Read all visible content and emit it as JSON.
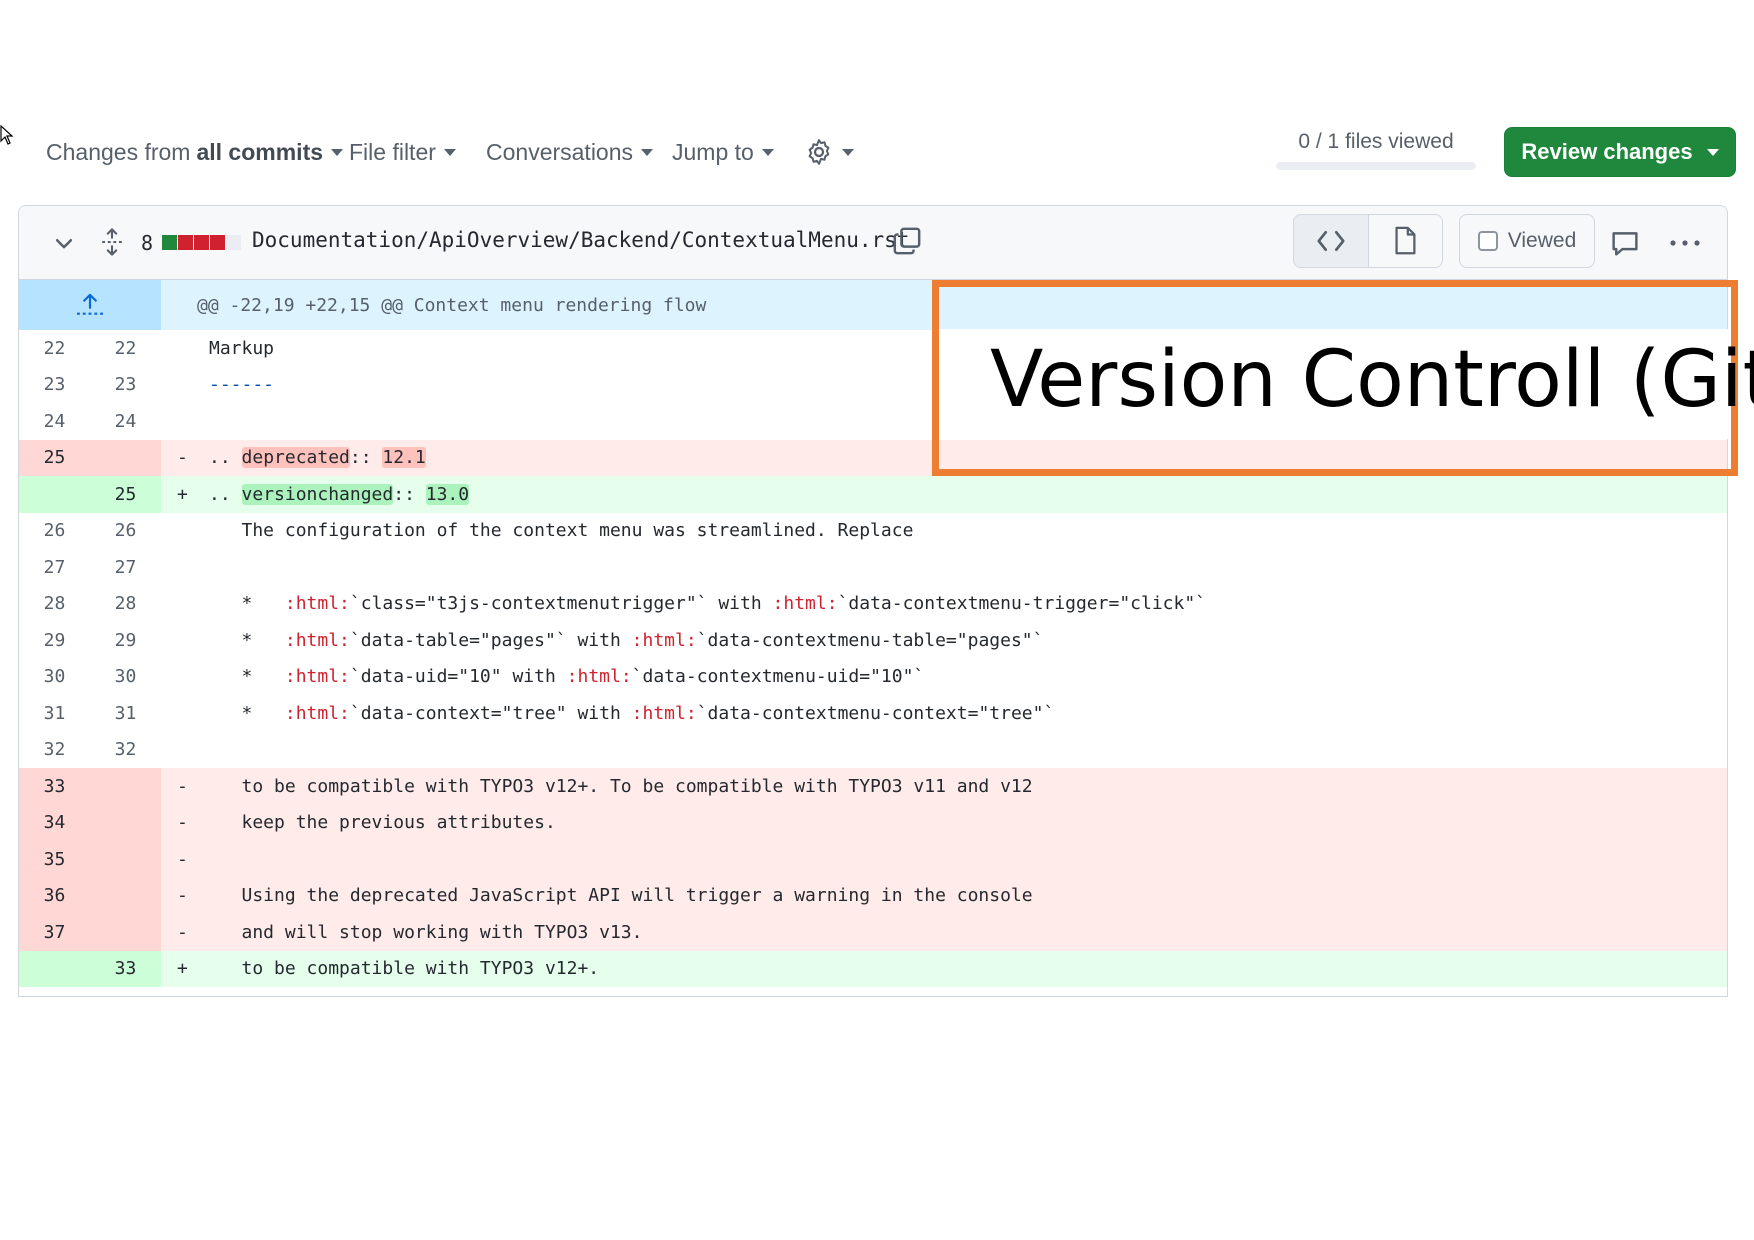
{
  "toolbar": {
    "changes_prefix": "Changes from",
    "changes_value": "all commits",
    "file_filter": "File filter",
    "conversations": "Conversations",
    "jump_to": "Jump to",
    "files_viewed": "0 / 1 files viewed",
    "files_viewed_progress": 0,
    "review_changes": "Review changes",
    "icons": [
      "settings-gear-icon",
      "caret-down-icon"
    ]
  },
  "file": {
    "changed_lines": "8",
    "diffstat": [
      "added",
      "deleted",
      "deleted",
      "deleted",
      "neutral"
    ],
    "diffstat_colors": {
      "added": "#1f883d",
      "deleted": "#cf222e",
      "neutral": "#eaeef2"
    },
    "path": "Documentation/ApiOverview/Backend/ContextualMenu.rst",
    "viewed_label": "Viewed",
    "icons": [
      "collapse-chevron-icon",
      "expand-all-icon",
      "copy-path-icon",
      "code-view-icon",
      "file-view-icon",
      "comment-icon",
      "more-options-icon"
    ]
  },
  "diff": {
    "hunk_header": "@@ -22,19 +22,15 @@ Context menu rendering flow",
    "lines": [
      {
        "type": "ctx",
        "old": "22",
        "new": "22",
        "sign": "",
        "text": "Markup"
      },
      {
        "type": "ctx",
        "old": "23",
        "new": "23",
        "sign": "",
        "text": "------"
      },
      {
        "type": "ctx",
        "old": "24",
        "new": "24",
        "sign": "",
        "text": ""
      },
      {
        "type": "del",
        "old": "25",
        "new": "",
        "sign": "-",
        "prefix": "..",
        "hl": "deprecated",
        "mid": ":: ",
        "hl2": "12.1"
      },
      {
        "type": "add",
        "old": "",
        "new": "25",
        "sign": "+",
        "prefix": "..",
        "hl": "versionchanged",
        "mid": ":: ",
        "hl2": "13.0"
      },
      {
        "type": "ctx",
        "old": "26",
        "new": "26",
        "sign": "",
        "text": "   The configuration of the context menu was streamlined. Replace"
      },
      {
        "type": "ctx",
        "old": "27",
        "new": "27",
        "sign": "",
        "text": ""
      },
      {
        "type": "ctx",
        "old": "28",
        "new": "28",
        "sign": "",
        "text": "   *   :html:`class=\"t3js-contextmenutrigger\"` with :html:`data-contextmenu-trigger=\"click\"`"
      },
      {
        "type": "ctx",
        "old": "29",
        "new": "29",
        "sign": "",
        "text": "   *   :html:`data-table=\"pages\"` with :html:`data-contextmenu-table=\"pages\"`"
      },
      {
        "type": "ctx",
        "old": "30",
        "new": "30",
        "sign": "",
        "text": "   *   :html:`data-uid=\"10\" with :html:`data-contextmenu-uid=\"10\"`"
      },
      {
        "type": "ctx",
        "old": "31",
        "new": "31",
        "sign": "",
        "text": "   *   :html:`data-context=\"tree\" with :html:`data-contextmenu-context=\"tree\"`"
      },
      {
        "type": "ctx",
        "old": "32",
        "new": "32",
        "sign": "",
        "text": ""
      },
      {
        "type": "del",
        "old": "33",
        "new": "",
        "sign": "-",
        "text": "   to be compatible with TYPO3 v12+. To be compatible with TYPO3 v11 and v12"
      },
      {
        "type": "del",
        "old": "34",
        "new": "",
        "sign": "-",
        "text": "   keep the previous attributes."
      },
      {
        "type": "del",
        "old": "35",
        "new": "",
        "sign": "-",
        "text": ""
      },
      {
        "type": "del",
        "old": "36",
        "new": "",
        "sign": "-",
        "text": "   Using the deprecated JavaScript API will trigger a warning in the console"
      },
      {
        "type": "del",
        "old": "37",
        "new": "",
        "sign": "-",
        "text": "   and will stop working with TYPO3 v13."
      },
      {
        "type": "add",
        "old": "",
        "new": "33",
        "sign": "+",
        "text": "   to be compatible with TYPO3 v12+."
      }
    ]
  },
  "overlay": {
    "title": "Version Controll (Git)",
    "border_color": "#ed7d31"
  }
}
